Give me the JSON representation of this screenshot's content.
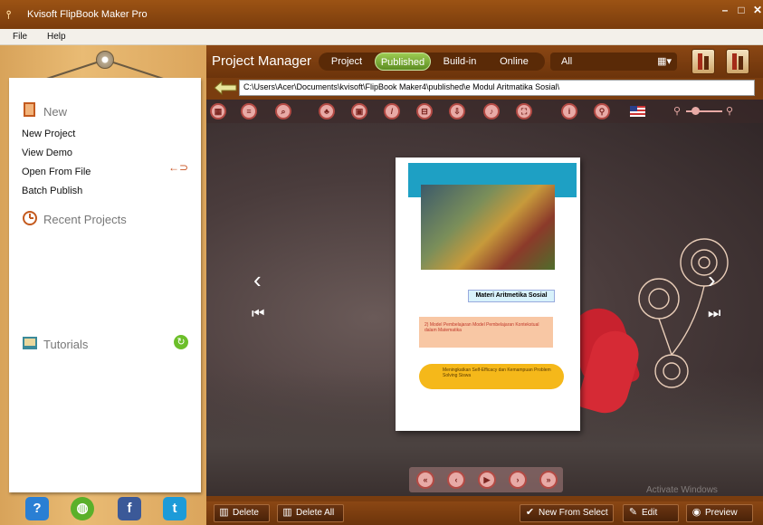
{
  "window": {
    "title": "Kvisoft FlipBook Maker Pro"
  },
  "menu": {
    "file": "File",
    "help": "Help"
  },
  "left": {
    "new_title": "New",
    "links": [
      "New Project",
      "View Demo",
      "Open From File",
      "Batch Publish"
    ],
    "recent_title": "Recent Projects",
    "tutorials_title": "Tutorials"
  },
  "right": {
    "title": "Project Manager",
    "tabs": [
      "Project",
      "Published",
      "Build-in",
      "Online"
    ],
    "active_tab": "Published",
    "filter_value": "All",
    "path": "C:\\Users\\Acer\\Documents\\kvisoft\\FlipBook Maker4\\published\\e Modul Aritmatika Sosial\\"
  },
  "book": {
    "page_title": "Materi Aritmetika Sosial",
    "pink_text": "2) Model Pembelajaran Model Pembelajaran Kontekstual dalam Matematika",
    "yellow_text": "Meningkatkan Self-Efficacy dan Kemampuan Problem Solving Siswa"
  },
  "bottom": {
    "delete": "Delete",
    "delete_all": "Delete All",
    "new_from_select": "New From Select",
    "edit": "Edit",
    "preview": "Preview"
  },
  "watermark": "Activate Windows"
}
